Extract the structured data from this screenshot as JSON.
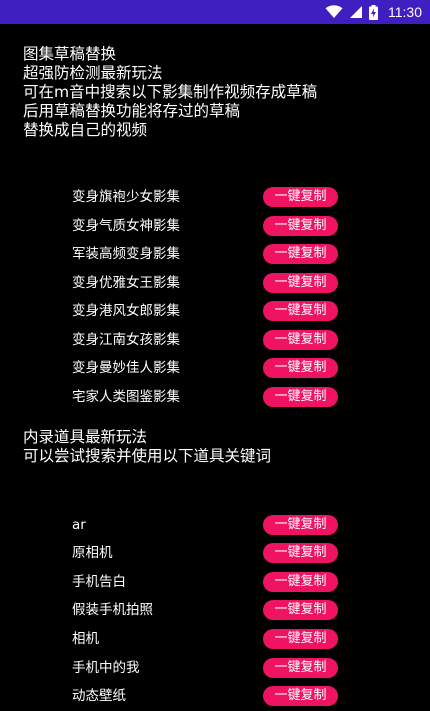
{
  "status_bar": {
    "time": "11:30",
    "icons": [
      "wifi-icon",
      "signal-icon",
      "battery-charging-icon"
    ],
    "background_color": "#3f1fbf"
  },
  "section1": {
    "lines": [
      "图集草稿替换",
      "超强防检测最新玩法",
      "可在m音中搜索以下影集制作视频存成草稿",
      "后用草稿替换功能将存过的草稿",
      "替换成自己的视频"
    ],
    "items": [
      {
        "label": "变身旗袍少女影集",
        "button": "一键复制"
      },
      {
        "label": "变身气质女神影集",
        "button": "一键复制"
      },
      {
        "label": "军装高频变身影集",
        "button": "一键复制"
      },
      {
        "label": "变身优雅女王影集",
        "button": "一键复制"
      },
      {
        "label": "变身港风女郎影集",
        "button": "一键复制"
      },
      {
        "label": "变身江南女孩影集",
        "button": "一键复制"
      },
      {
        "label": "变身曼妙佳人影集",
        "button": "一键复制"
      },
      {
        "label": "宅家人类图鉴影集",
        "button": "一键复制"
      }
    ]
  },
  "section2": {
    "lines": [
      "内录道具最新玩法",
      "可以尝试搜索并使用以下道具关键词"
    ],
    "items": [
      {
        "label": "ar",
        "button": "一键复制"
      },
      {
        "label": "原相机",
        "button": "一键复制"
      },
      {
        "label": "手机告白",
        "button": "一键复制"
      },
      {
        "label": "假装手机拍照",
        "button": "一键复制"
      },
      {
        "label": "相机",
        "button": "一键复制"
      },
      {
        "label": "手机中的我",
        "button": "一键复制"
      },
      {
        "label": "动态壁纸",
        "button": "一键复制"
      }
    ]
  },
  "colors": {
    "background": "#000000",
    "text": "#ffffff",
    "button": "#ef1462"
  }
}
